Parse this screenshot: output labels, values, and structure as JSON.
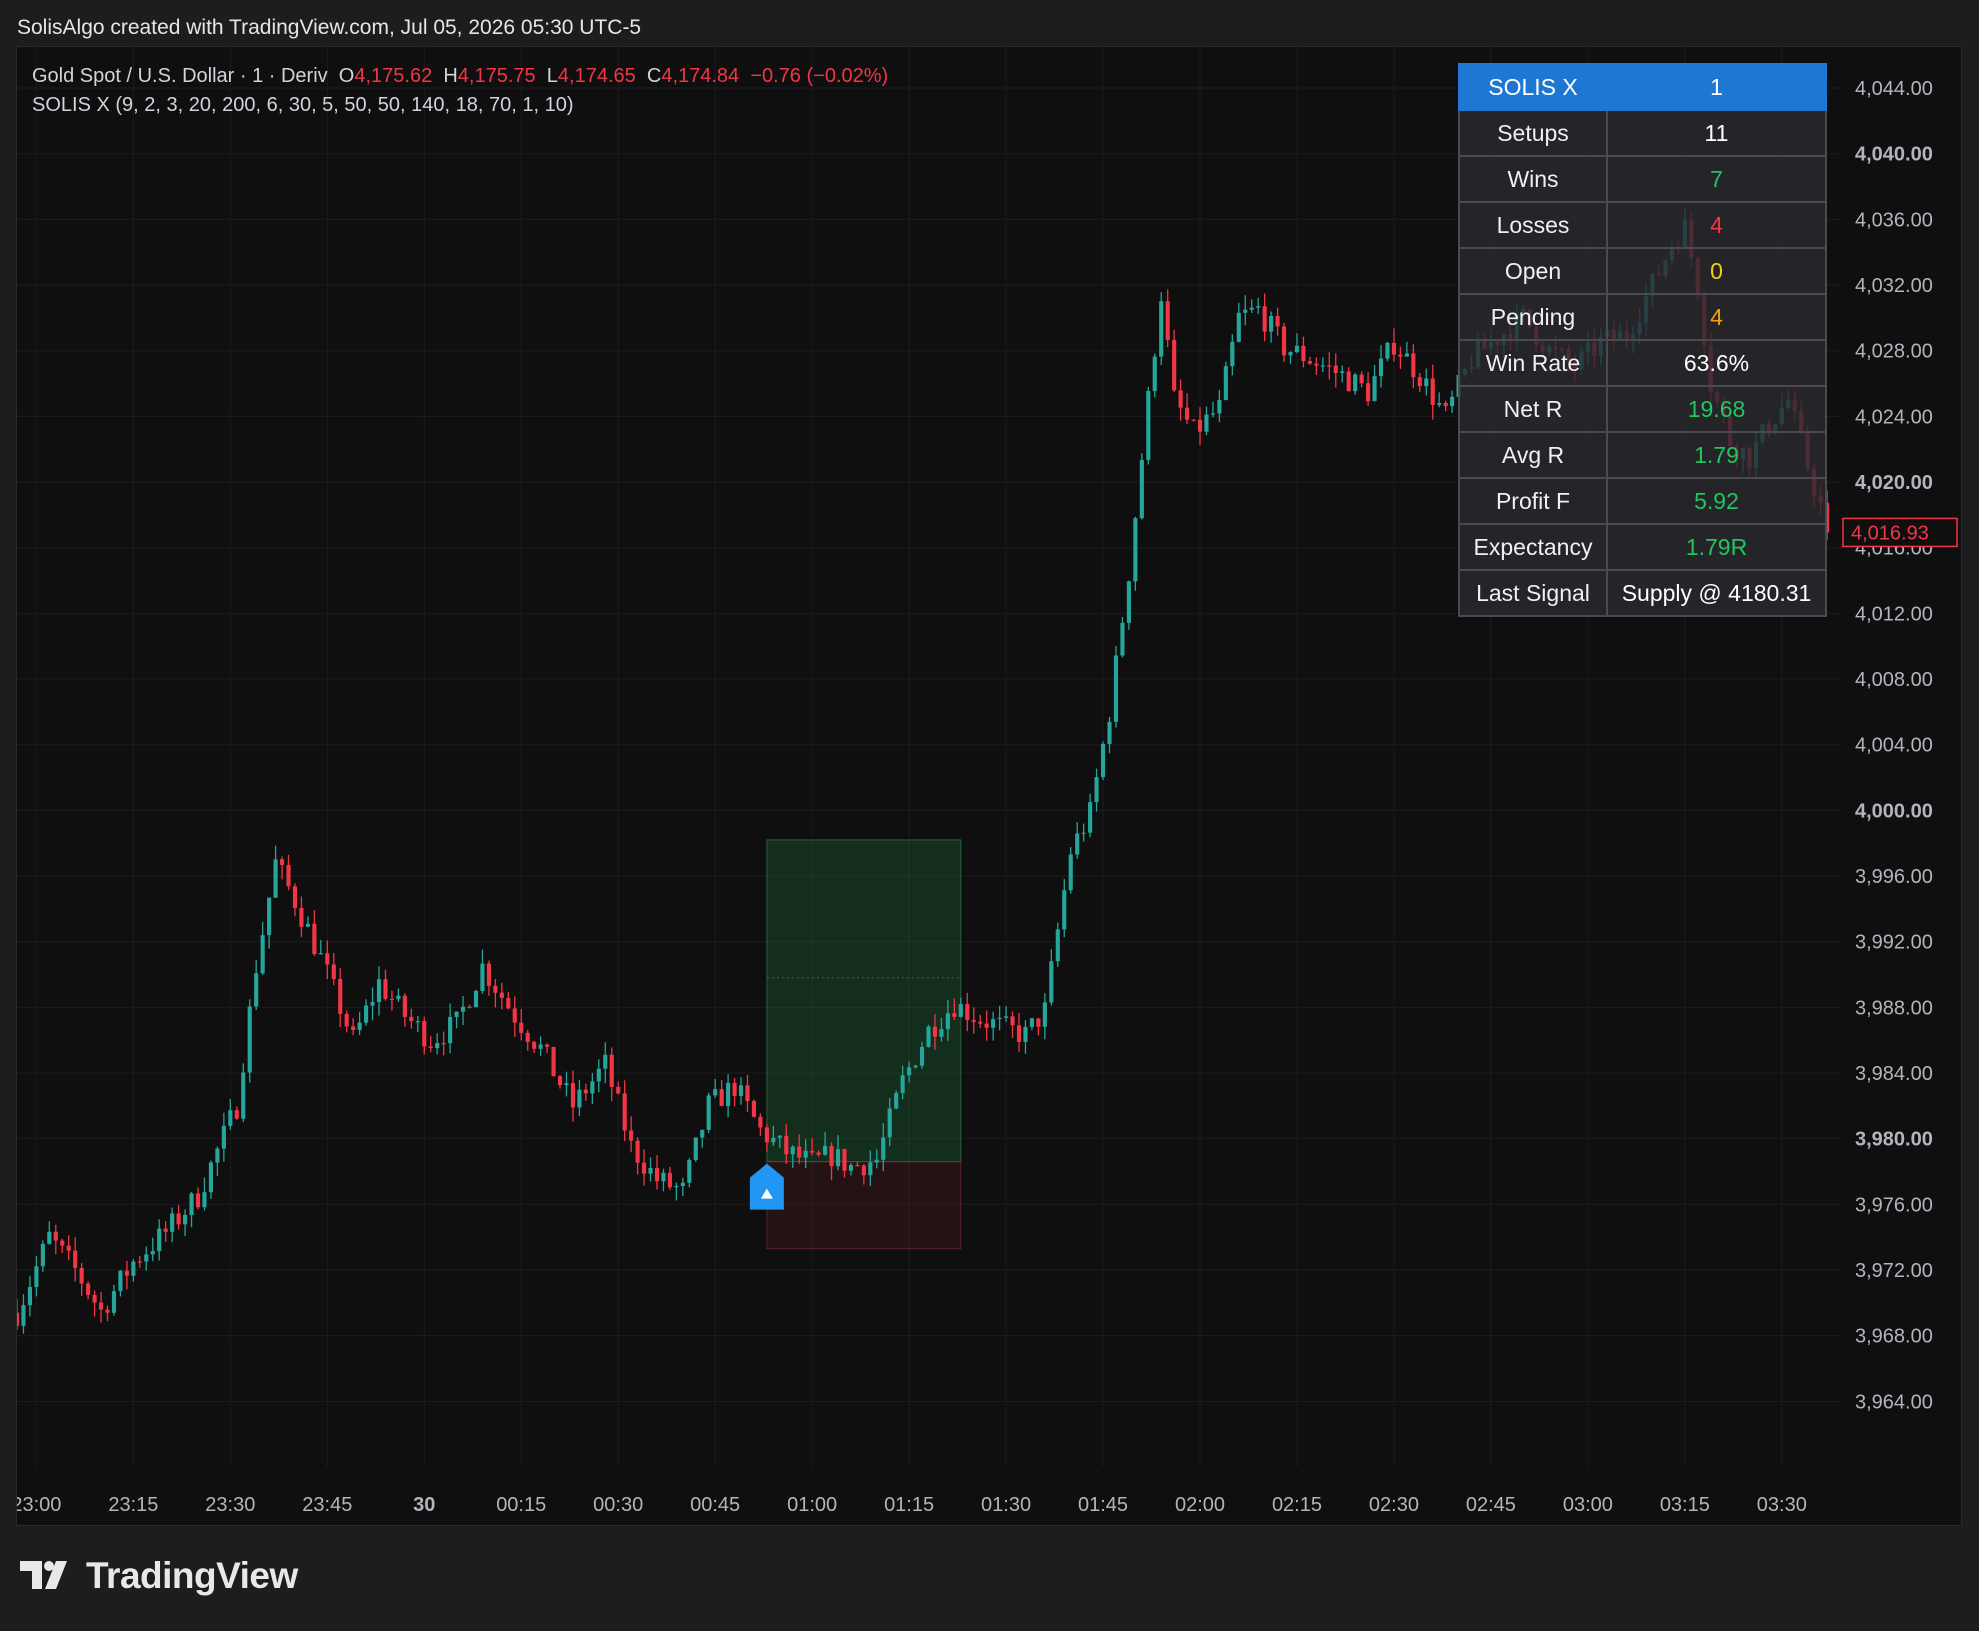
{
  "attribution": "SolisAlgo created with TradingView.com, Jul 05, 2026 05:30 UTC-5",
  "legend": {
    "symbol": "Gold Spot / U.S. Dollar · 1 · Deriv",
    "open": "4,175.62",
    "high": "4,175.75",
    "low": "4,174.65",
    "close": "4,174.84",
    "change": "−0.76 (−0.02%)",
    "indicator": "SOLIS X (9, 2, 3, 20, 200, 6, 30, 5, 50, 50, 140, 18, 70, 1, 10)"
  },
  "stats_table": {
    "header": {
      "label": "SOLIS X",
      "value": "1"
    },
    "rows": [
      {
        "label": "Setups",
        "value": "11",
        "color": "#ffffff"
      },
      {
        "label": "Wins",
        "value": "7",
        "color": "#22c55e"
      },
      {
        "label": "Losses",
        "value": "4",
        "color": "#f23645"
      },
      {
        "label": "Open",
        "value": "0",
        "color": "#facc15"
      },
      {
        "label": "Pending",
        "value": "4",
        "color": "#f59e0b"
      },
      {
        "label": "Win Rate",
        "value": "63.6%",
        "color": "#ffffff"
      },
      {
        "label": "Net R",
        "value": "19.68",
        "color": "#22c55e"
      },
      {
        "label": "Avg R",
        "value": "1.79",
        "color": "#22c55e"
      },
      {
        "label": "Profit F",
        "value": "5.92",
        "color": "#22c55e"
      },
      {
        "label": "Expectancy",
        "value": "1.79R",
        "color": "#22c55e"
      },
      {
        "label": "Last Signal",
        "value": "Supply @ 4180.31",
        "color": "#ffffff"
      }
    ]
  },
  "price_label": "4,016.93",
  "brand": "TradingView",
  "colors": {
    "up": "#26a69a",
    "down": "#f23645",
    "background": "#0f0f10",
    "grid": "#1c1c1f",
    "axis_text": "#b2b5be"
  },
  "chart_data": {
    "type": "candlestick",
    "y_ticks": [
      "3,964.00",
      "3,968.00",
      "3,972.00",
      "3,976.00",
      "3,980.00",
      "3,984.00",
      "3,988.00",
      "3,992.00",
      "3,996.00",
      "4,000.00",
      "4,004.00",
      "4,008.00",
      "4,012.00",
      "4,016.00",
      "4,020.00",
      "4,024.00",
      "4,028.00",
      "4,032.00",
      "4,036.00",
      "4,040.00",
      "4,044.00"
    ],
    "bold_ticks": [
      "3,980.00",
      "4,000.00",
      "4,020.00",
      "4,040.00"
    ],
    "ylim": [
      3960,
      4046.5
    ],
    "x_ticks": [
      "23:00",
      "23:15",
      "23:30",
      "23:45",
      "30",
      "00:15",
      "00:30",
      "00:45",
      "01:00",
      "01:15",
      "01:30",
      "01:45",
      "02:00",
      "02:15",
      "02:30",
      "02:45",
      "03:00",
      "03:15",
      "03:30"
    ],
    "bold_x_ticks": [
      "30"
    ],
    "xlim_minutes": [
      -3,
      279
    ],
    "last_price": 4016.93,
    "anchors": [
      [
        -3,
        3969.4
      ],
      [
        2,
        3974
      ],
      [
        6,
        3972
      ],
      [
        10,
        3969.5
      ],
      [
        15,
        3972.5
      ],
      [
        20,
        3974.3
      ],
      [
        25,
        3976.5
      ],
      [
        31,
        3982
      ],
      [
        34,
        3990.5
      ],
      [
        37,
        3996.8
      ],
      [
        40,
        3994.5
      ],
      [
        44,
        3991
      ],
      [
        49,
        3986
      ],
      [
        53,
        3989.5
      ],
      [
        57,
        3987.5
      ],
      [
        61,
        3986
      ],
      [
        65,
        3987
      ],
      [
        69,
        3990.5
      ],
      [
        74,
        3987.5
      ],
      [
        78,
        3985.5
      ],
      [
        83,
        3982
      ],
      [
        88,
        3984.5
      ],
      [
        92,
        3979.5
      ],
      [
        96,
        3977.5
      ],
      [
        100,
        3976.8
      ],
      [
        104,
        3982
      ],
      [
        108,
        3983.2
      ],
      [
        112,
        3980.5
      ],
      [
        116,
        3979.2
      ],
      [
        120,
        3978.5
      ],
      [
        123,
        3979
      ],
      [
        126,
        3978.3
      ],
      [
        130,
        3978.7
      ],
      [
        134,
        3983.5
      ],
      [
        138,
        3986.6
      ],
      [
        142,
        3988.2
      ],
      [
        146,
        3987.3
      ],
      [
        150,
        3986.7
      ],
      [
        153,
        3986.3
      ],
      [
        156,
        3987.8
      ],
      [
        160,
        3997.5
      ],
      [
        163,
        3999.8
      ],
      [
        166,
        4006
      ],
      [
        169,
        4014.5
      ],
      [
        172,
        4025
      ],
      [
        174,
        4031.5
      ],
      [
        176,
        4025
      ],
      [
        179,
        4023
      ],
      [
        183,
        4024.5
      ],
      [
        186,
        4030
      ],
      [
        189,
        4030.5
      ],
      [
        193,
        4028.2
      ],
      [
        197,
        4027.5
      ],
      [
        202,
        4026.5
      ],
      [
        206,
        4025.5
      ],
      [
        210,
        4028.5
      ],
      [
        214,
        4026.5
      ],
      [
        218,
        4024
      ],
      [
        222,
        4027.5
      ],
      [
        226,
        4028.8
      ],
      [
        230,
        4030
      ],
      [
        234,
        4028
      ],
      [
        238,
        4027
      ],
      [
        242,
        4028.5
      ],
      [
        246,
        4029
      ],
      [
        250,
        4032
      ],
      [
        253,
        4034.5
      ],
      [
        255,
        4035.5
      ],
      [
        257,
        4032
      ],
      [
        259,
        4026
      ],
      [
        262,
        4022.5
      ],
      [
        265,
        4021.5
      ],
      [
        268,
        4023.5
      ],
      [
        271,
        4025
      ],
      [
        274,
        4021
      ],
      [
        276,
        4018.5
      ],
      [
        277,
        4017.3
      ]
    ],
    "long_position": {
      "entry_minute": 113,
      "exit_minute": 143,
      "entry_price": 3978.6,
      "target_price": 3998.2,
      "stop_price": 3973.3
    },
    "buy_signal_minute": 113
  }
}
